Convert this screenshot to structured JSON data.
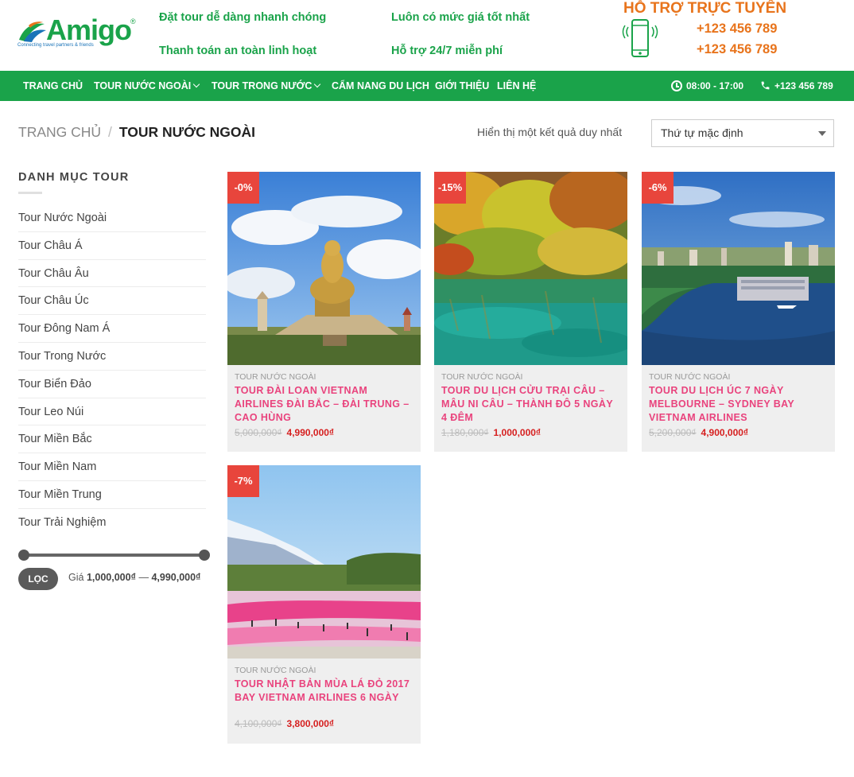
{
  "brand": {
    "name": "Amigo",
    "registered": "®",
    "tagline": "Connecting travel partners & friends",
    "primary_color": "#1aa34a",
    "accent_color": "#e8741c",
    "sale_color": "#e8453c",
    "title_color": "#e9437d"
  },
  "features": [
    "Đặt tour dễ dàng nhanh chóng",
    "Luôn có mức giá tốt nhất",
    "Thanh toán an toàn linh hoạt",
    "Hỗ trợ 24/7 miễn phí"
  ],
  "support": {
    "title": "HỖ TRỢ TRỰC TUYẾN",
    "icon": "phone-icon",
    "phones": [
      "+123 456 789",
      "+123 456 789"
    ]
  },
  "nav": {
    "items": [
      {
        "label": "TRANG CHỦ",
        "dropdown": false
      },
      {
        "label": "TOUR NƯỚC NGOÀI",
        "dropdown": true
      },
      {
        "label": "TOUR TRONG NƯỚC",
        "dropdown": true
      },
      {
        "label": "CẨM NANG DU LỊCH",
        "dropdown": false
      },
      {
        "label": "GIỚI THIỆU",
        "dropdown": false
      },
      {
        "label": "LIÊN HỆ",
        "dropdown": false
      }
    ],
    "hours": "08:00 - 17:00",
    "phone": "+123 456 789"
  },
  "breadcrumb": {
    "home": "TRANG CHỦ",
    "separator": "/",
    "current": "TOUR NƯỚC NGOÀI"
  },
  "results": {
    "count_text": "Hiển thị một kết quả duy nhất",
    "sort_selected": "Thứ tự mặc định"
  },
  "sidebar": {
    "title": "DANH MỤC TOUR",
    "categories": [
      "Tour Nước Ngoài",
      "Tour Châu Á",
      "Tour Châu Âu",
      "Tour Châu Úc",
      "Tour Đông Nam Á",
      "Tour Trong Nước",
      "Tour Biển Đảo",
      "Tour Leo Núi",
      "Tour Miền Bắc",
      "Tour Miền Nam",
      "Tour Miền Trung",
      "Tour Trải Nghiệm"
    ],
    "filter": {
      "button": "LỌC",
      "price_label": "Giá",
      "min": "1,000,000₫",
      "dash": "—",
      "max": "4,990,000₫"
    }
  },
  "products": [
    {
      "badge": "-0%",
      "category": "TOUR NƯỚC NGOÀI",
      "title": "TOUR ĐÀI LOAN VIETNAM AIRLINES ĐÀI BẮC – ĐÀI TRUNG – CAO HÙNG",
      "old_price": "5,000,000₫",
      "price": "4,990,000₫",
      "image": "buddha-statue"
    },
    {
      "badge": "-15%",
      "category": "TOUR NƯỚC NGOÀI",
      "title": "TOUR DU LỊCH CỬU TRẠI CÂU – MÂU NI CÂU – THÀNH ĐÔ 5 NGÀY 4 ĐÊM",
      "old_price": "1,180,000₫",
      "price": "1,000,000₫",
      "image": "autumn-lake"
    },
    {
      "badge": "-6%",
      "category": "TOUR NƯỚC NGOÀI",
      "title": "TOUR DU LỊCH ÚC 7 NGÀY MELBOURNE – SYDNEY BAY VIETNAM AIRLINES",
      "old_price": "5,200,000₫",
      "price": "4,900,000₫",
      "image": "sydney-harbour"
    },
    {
      "badge": "-7%",
      "category": "TOUR NƯỚC NGOÀI",
      "title": "TOUR NHẬT BẢN MÙA LÁ ĐỎ 2017 BAY VIETNAM AIRLINES 6 NGÀY",
      "old_price": "4,100,000₫",
      "price": "3,800,000₫",
      "image": "fuji-flower-field"
    }
  ]
}
